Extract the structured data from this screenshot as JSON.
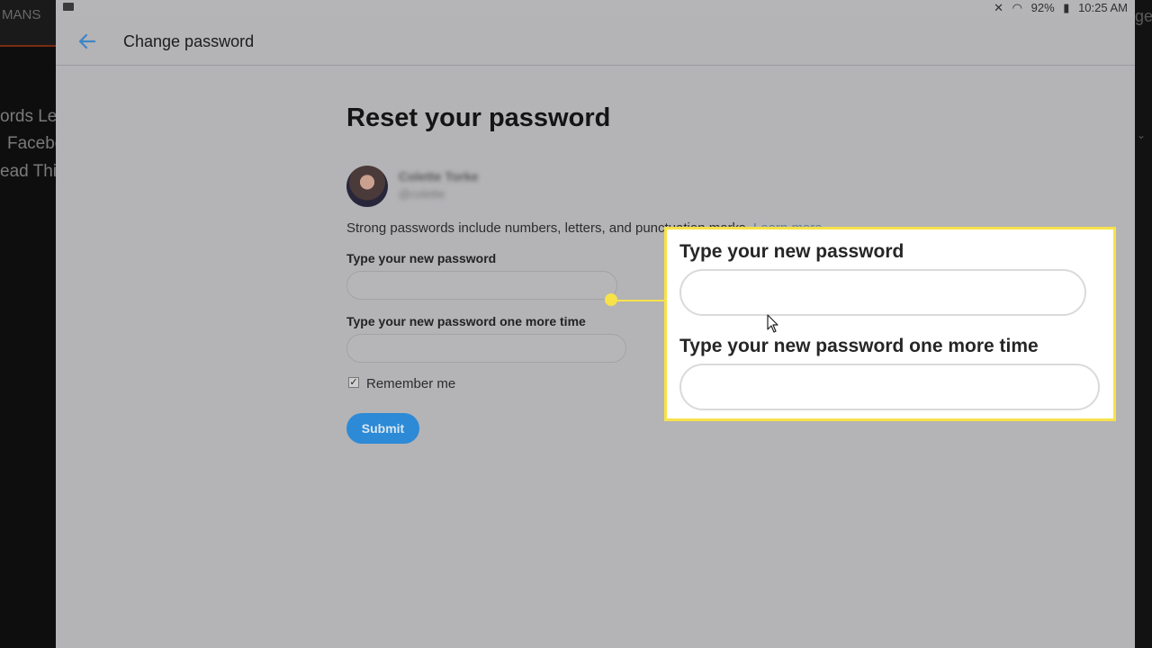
{
  "background": {
    "left_tab_text": "MANS",
    "left_lines": [
      "ords Le",
      "Facebo",
      "ead This"
    ],
    "right_tab_text": "ge"
  },
  "statusbar": {
    "battery": "92%",
    "time": "10:25 AM"
  },
  "header": {
    "title": "Change password"
  },
  "main": {
    "title": "Reset your password",
    "user_name": "Colette Torke",
    "user_handle": "@colette",
    "hint": "Strong passwords include numbers, letters, and punctuation marks.",
    "learn_more": "Learn more",
    "new_password_label": "Type your new password",
    "confirm_password_label": "Type your new password one more time",
    "remember_label": "Remember me",
    "remember_checked": true,
    "submit_label": "Submit"
  },
  "callout": {
    "new_password_label": "Type your new password",
    "confirm_password_label": "Type your new password one more time"
  },
  "colors": {
    "highlight": "#f7e24a",
    "accent": "#2c8ad6"
  }
}
